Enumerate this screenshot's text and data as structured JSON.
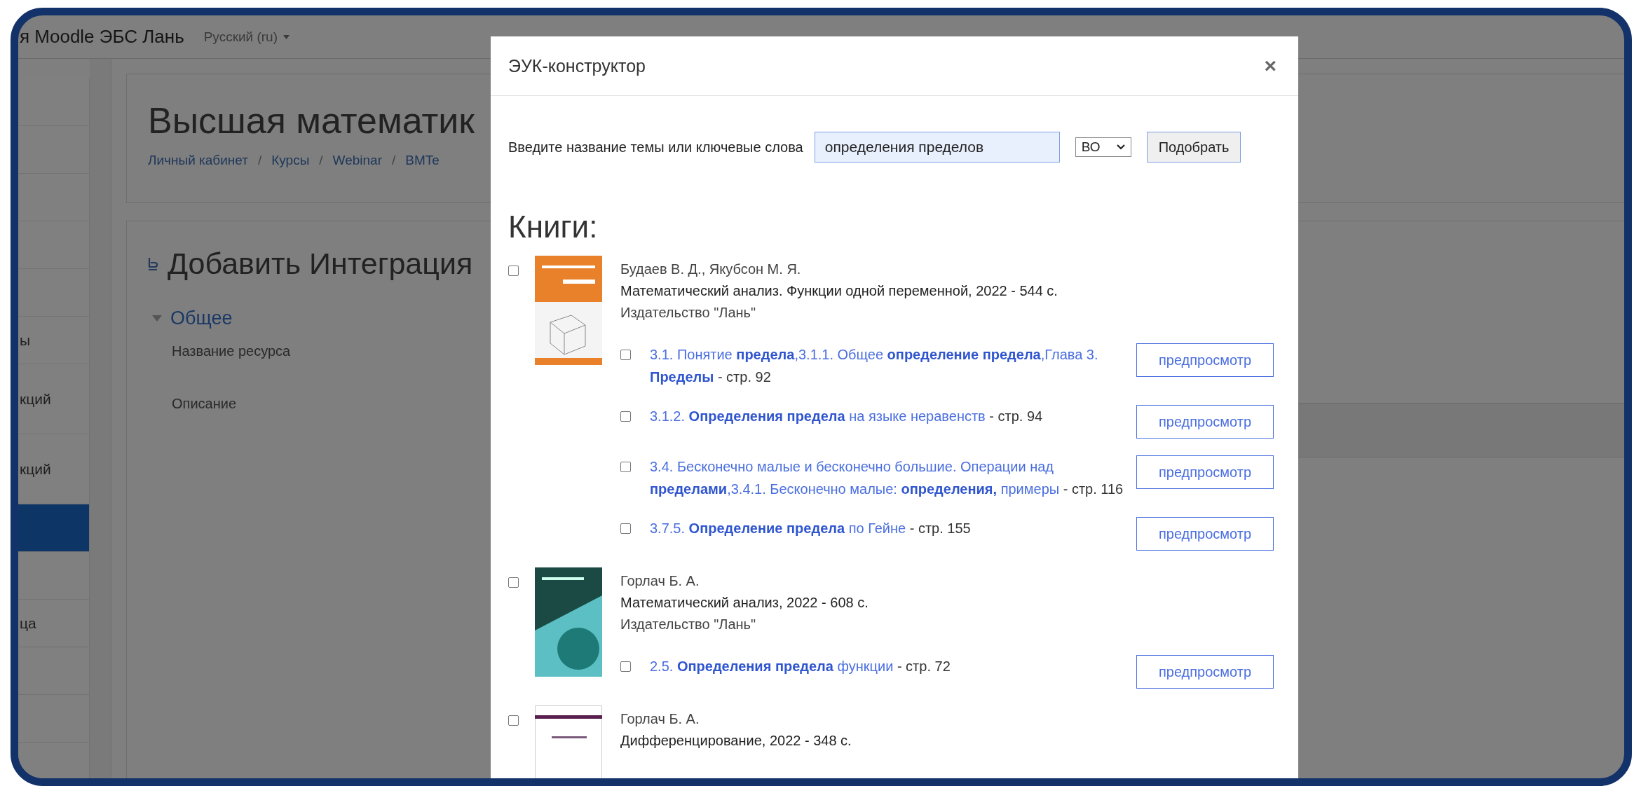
{
  "header": {
    "site_title": "я Moodle ЭБС Лань",
    "language": "Русский (ru)"
  },
  "sidebar": {
    "items": [
      {
        "selected": false
      },
      {
        "selected": false
      },
      {
        "selected": false
      },
      {
        "selected": false
      },
      {
        "selected": false
      },
      {
        "label": "ы",
        "selected": false
      },
      {
        "label": "кций",
        "selected": false
      },
      {
        "label": "кций",
        "selected": false
      },
      {
        "selected": true
      },
      {
        "selected": false
      },
      {
        "label": "ца",
        "selected": false
      },
      {
        "selected": false
      },
      {
        "selected": false
      },
      {
        "selected": false
      }
    ]
  },
  "page": {
    "title": "Высшая математик",
    "breadcrumb": {
      "separator": "/",
      "items": [
        "Личный кабинет",
        "Курсы",
        "Webinar",
        "BMTe"
      ]
    },
    "form_title": "Добавить Интеграция",
    "section": {
      "title": "Общее",
      "expanded": true
    },
    "fields": [
      "Название ресурса",
      "Описание"
    ]
  },
  "modal": {
    "title": "ЭУК-конструктор",
    "close": "×",
    "search_label": "Введите название темы или ключевые слова",
    "query": "определения пределов",
    "level": "ВО",
    "submit": "Подобрать",
    "section_title": "Книги:",
    "books": [
      {
        "kind": "geometry",
        "checked": false,
        "authors": "Будаев В. Д., Якубсон М. Я.",
        "title": "Математический анализ. Функции одной переменной, 2022 - 544 с.",
        "publisher": "Издательство \"Лань\"",
        "chapters": [
          {
            "checked": false,
            "link": "3.1. Понятие **предела**,3.1.1. Общее **определение предела**,Глава 3. **Пределы**",
            "page": "- стр. 92",
            "preview": "предпросмотр"
          },
          {
            "checked": false,
            "link": "3.1.2. **Определения предела** на языке неравенств",
            "page": "- стр. 94",
            "preview": "предпросмотр"
          },
          {
            "checked": false,
            "link": "3.4. Бесконечно малые и бесконечно большие. Операции над **пределами**,3.4.1. Бесконечно малые: **определения,** примеры",
            "page": "- стр. 116",
            "preview": "предпросмотр"
          },
          {
            "checked": false,
            "link": "3.7.5. **Определение предела** по Гейне",
            "page": "- стр. 155",
            "preview": "предпросмотр"
          }
        ]
      },
      {
        "kind": "sphere",
        "checked": false,
        "authors": "Горлач Б. А.",
        "title": "Математический анализ, 2022 - 608 с.",
        "publisher": "Издательство \"Лань\"",
        "chapters": [
          {
            "checked": false,
            "link": "2.5. **Определения предела** функции",
            "page": "- стр. 72",
            "preview": "предпросмотр"
          }
        ]
      },
      {
        "kind": "banded",
        "checked": false,
        "authors": "Горлач Б. А.",
        "title": "Дифференцирование, 2022 - 348 с."
      }
    ]
  }
}
